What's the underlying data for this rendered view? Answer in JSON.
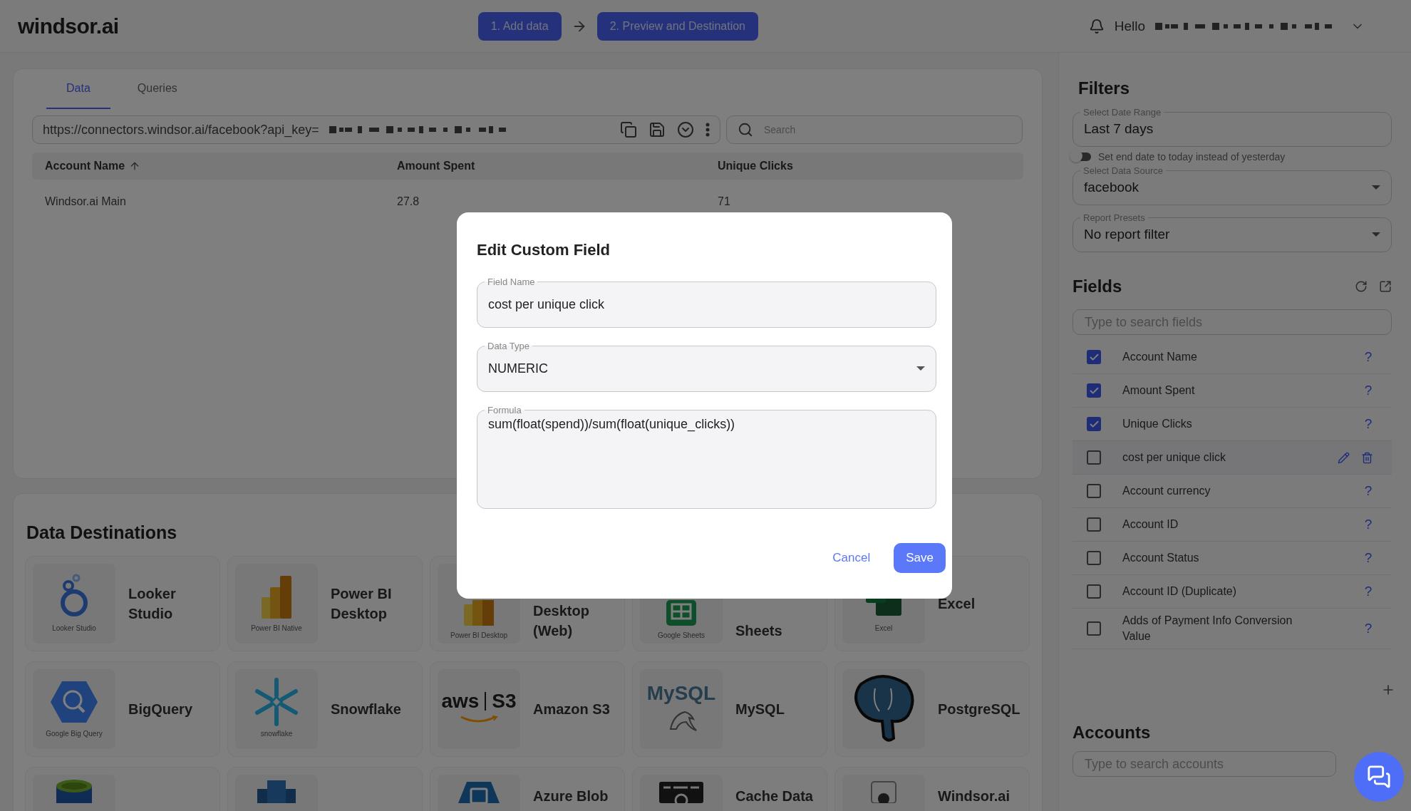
{
  "header": {
    "logo": "windsor.ai",
    "steps": [
      {
        "label": "1. Add data"
      },
      {
        "label": "2. Preview and Destination"
      }
    ],
    "greeting": "Hello"
  },
  "data_panel": {
    "tabs": [
      {
        "label": "Data",
        "selected": true
      },
      {
        "label": "Queries",
        "selected": false
      }
    ],
    "url": "https://connectors.windsor.ai/facebook?api_key=",
    "search": {
      "placeholder": "Search"
    },
    "table": {
      "columns": [
        {
          "label": "Account Name",
          "sorted": true
        },
        {
          "label": "Amount Spent",
          "sorted": false
        },
        {
          "label": "Unique Clicks",
          "sorted": false
        }
      ],
      "rows": [
        [
          "Windsor.ai Main",
          "27.8",
          "71"
        ]
      ]
    }
  },
  "destinations": {
    "title": "Data Destinations",
    "items": [
      {
        "kind": "full",
        "name": "Looker Studio",
        "logo_caption": "Looker Studio"
      },
      {
        "kind": "full",
        "name": "Power BI Desktop",
        "logo_caption": "Power BI Native"
      },
      {
        "kind": "covered",
        "name": "Desktop (Web)",
        "logo_caption": "Power BI Desktop"
      },
      {
        "kind": "covered",
        "name": "Sheets",
        "logo_caption": "Google Sheets"
      },
      {
        "kind": "full",
        "name": "Excel",
        "logo_caption": "Excel"
      },
      {
        "kind": "full",
        "name": "BigQuery",
        "logo_caption": "Google Big Query"
      },
      {
        "kind": "full",
        "name": "Snowflake",
        "logo_caption": "snowflake"
      },
      {
        "kind": "full",
        "name": "Amazon S3",
        "logo_wordmark": [
          "aws",
          "S3"
        ]
      },
      {
        "kind": "full",
        "name": "MySQL",
        "logo_wordmark": [
          "MySQL"
        ]
      },
      {
        "kind": "full",
        "name": "PostgreSQL"
      },
      {
        "kind": "cut"
      },
      {
        "kind": "cut"
      },
      {
        "kind": "cut",
        "name": "Azure Blob"
      },
      {
        "kind": "cut",
        "name": "Cache Data"
      },
      {
        "kind": "cut",
        "name": "Windsor.ai"
      }
    ]
  },
  "filters": {
    "title": "Filters",
    "date_range": {
      "label": "Select Date Range",
      "value": "Last 7 days"
    },
    "end_date_toggle": {
      "label": "Set end date to today instead of yesterday",
      "on": false
    },
    "data_source": {
      "label": "Select Data Source",
      "value": "facebook"
    },
    "report_presets": {
      "label": "Report Presets",
      "value": "No report filter"
    }
  },
  "fields": {
    "title": "Fields",
    "search": {
      "placeholder": "Type to search fields"
    },
    "items": [
      {
        "label": "Account Name",
        "checked": true,
        "kind": "standard",
        "help": "?"
      },
      {
        "label": "Amount Spent",
        "checked": true,
        "kind": "standard",
        "help": "?"
      },
      {
        "label": "Unique Clicks",
        "checked": true,
        "kind": "standard",
        "help": "?"
      },
      {
        "label": "cost per unique click",
        "checked": false,
        "kind": "custom"
      },
      {
        "label": "Account currency",
        "checked": false,
        "kind": "standard",
        "help": "?"
      },
      {
        "label": "Account ID",
        "checked": false,
        "kind": "standard",
        "help": "?"
      },
      {
        "label": "Account Status",
        "checked": false,
        "kind": "standard",
        "help": "?"
      },
      {
        "label": "Account ID (Duplicate)",
        "checked": false,
        "kind": "standard",
        "help": "?"
      },
      {
        "label": "Adds of Payment Info Conversion Value",
        "checked": false,
        "kind": "standard",
        "help": "?"
      }
    ]
  },
  "accounts": {
    "title": "Accounts",
    "search": {
      "placeholder": "Type to search accounts"
    }
  },
  "dialog": {
    "title": "Edit Custom Field",
    "field_name": {
      "label": "Field Name",
      "value": "cost per unique click"
    },
    "data_type": {
      "label": "Data Type",
      "value": "NUMERIC"
    },
    "formula": {
      "label": "Formula",
      "value": "sum(float(spend))/sum(float(unique_clicks))"
    },
    "buttons": [
      {
        "label": "Cancel",
        "kind": "text"
      },
      {
        "label": "Save",
        "kind": "primary"
      }
    ]
  }
}
